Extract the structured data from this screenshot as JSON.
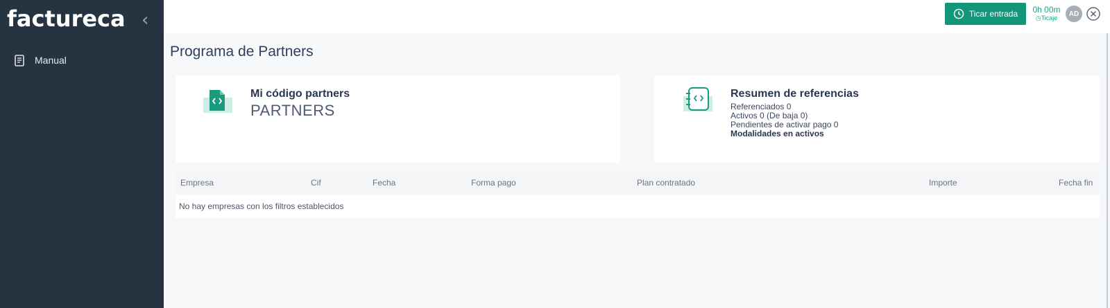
{
  "app": {
    "logo_text": "factureca"
  },
  "sidebar": {
    "items": [
      {
        "label": "Manual",
        "icon": "document-icon"
      }
    ]
  },
  "topbar": {
    "ticar_label": "Ticar entrada",
    "timer_value": "0h 00m",
    "timer_sub": "Ticaje",
    "avatar_initials": "AD"
  },
  "page": {
    "title": "Programa de Partners"
  },
  "partner_card": {
    "title": "Mi código partners",
    "code": "PARTNERS"
  },
  "summary_card": {
    "title": "Resumen de referencias",
    "lines": [
      "Referenciados 0",
      "Activos 0 (De baja 0)",
      "Pendientes de activar pago 0"
    ],
    "bold_line": "Modalidades en activos"
  },
  "table": {
    "columns": [
      "Empresa",
      "Cif",
      "Fecha",
      "Forma pago",
      "Plan contratado",
      "Importe",
      "Fecha fin"
    ],
    "empty_message": "No hay empresas con los filtros establecidos"
  },
  "colors": {
    "sidebar_bg": "#263341",
    "accent": "#13967a",
    "title": "#2f3f5c"
  }
}
